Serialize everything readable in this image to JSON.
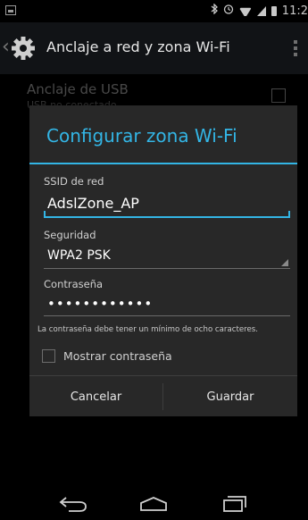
{
  "status_bar": {
    "time": "11:2",
    "icons": [
      "screenshot-icon",
      "bluetooth-icon",
      "alarm-icon",
      "wifi-icon",
      "signal-icon",
      "battery-icon"
    ]
  },
  "action_bar": {
    "title": "Anclaje a red y zona Wi-Fi",
    "icon": "settings-gear-icon"
  },
  "background_list": {
    "item_title": "Anclaje de USB",
    "item_subtitle": "USB no conectado"
  },
  "dialog": {
    "title": "Configurar zona Wi-Fi",
    "ssid_label": "SSID de red",
    "ssid_value": "AdslZone_AP",
    "security_label": "Seguridad",
    "security_value": "WPA2 PSK",
    "password_label": "Contraseña",
    "password_value": "••••••••••••",
    "password_hint": "La contraseña debe tener un mínimo de ocho caracteres.",
    "show_password_label": "Mostrar contraseña",
    "show_password_checked": false,
    "cancel_label": "Cancelar",
    "save_label": "Guardar"
  },
  "nav_bar": {
    "icons": [
      "back-icon",
      "home-icon",
      "recent-apps-icon"
    ]
  },
  "colors": {
    "accent": "#33b5e5",
    "dialog_bg": "#282828",
    "action_bar_bg": "#111316"
  }
}
